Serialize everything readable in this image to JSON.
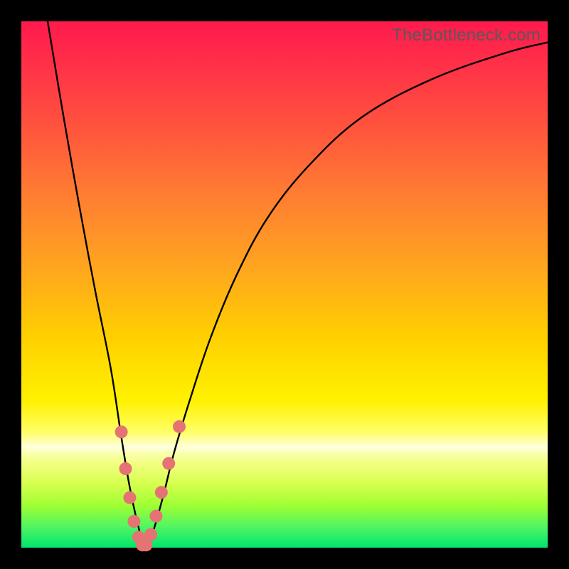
{
  "watermark": "TheBottleneck.com",
  "colors": {
    "frame": "#000000",
    "curve_stroke": "#000000",
    "dot_fill": "#e57373",
    "gradient_stops": [
      {
        "offset": 0.0,
        "color": "#ff1a4d"
      },
      {
        "offset": 0.06,
        "color": "#ff2a4a"
      },
      {
        "offset": 0.18,
        "color": "#ff4d3f"
      },
      {
        "offset": 0.32,
        "color": "#ff7a33"
      },
      {
        "offset": 0.46,
        "color": "#ffa320"
      },
      {
        "offset": 0.6,
        "color": "#ffd000"
      },
      {
        "offset": 0.72,
        "color": "#fff100"
      },
      {
        "offset": 0.78,
        "color": "#ffff66"
      },
      {
        "offset": 0.8,
        "color": "#ffffb8"
      },
      {
        "offset": 0.81,
        "color": "#ffffe0"
      },
      {
        "offset": 0.82,
        "color": "#fbffb0"
      },
      {
        "offset": 0.84,
        "color": "#f2ff80"
      },
      {
        "offset": 0.88,
        "color": "#d5ff4d"
      },
      {
        "offset": 0.92,
        "color": "#9eff33"
      },
      {
        "offset": 0.96,
        "color": "#52f562"
      },
      {
        "offset": 1.0,
        "color": "#00e56e"
      }
    ]
  },
  "chart_data": {
    "type": "line",
    "title": "",
    "xlabel": "",
    "ylabel": "",
    "xlim": [
      0,
      100
    ],
    "ylim": [
      0,
      100
    ],
    "series": [
      {
        "name": "bottleneck-curve",
        "x": [
          5,
          8,
          11,
          14,
          17,
          19,
          20.5,
          22,
          23.5,
          25,
          27,
          29,
          32,
          36,
          41,
          47,
          55,
          65,
          78,
          92,
          100
        ],
        "y": [
          100,
          82,
          65,
          49,
          34,
          21,
          12,
          5,
          0,
          3,
          10,
          18,
          28,
          40,
          52,
          63,
          73,
          82,
          89,
          94,
          96
        ]
      }
    ],
    "highlight_points": {
      "name": "near-zero-dots",
      "x": [
        19.0,
        19.8,
        20.6,
        21.4,
        22.3,
        23.0,
        23.7,
        24.6,
        25.6,
        26.6,
        28.0,
        30.0
      ],
      "y": [
        22.0,
        15.0,
        9.5,
        5.0,
        2.0,
        0.5,
        0.5,
        2.5,
        6.0,
        10.5,
        16.0,
        23.0
      ]
    }
  }
}
